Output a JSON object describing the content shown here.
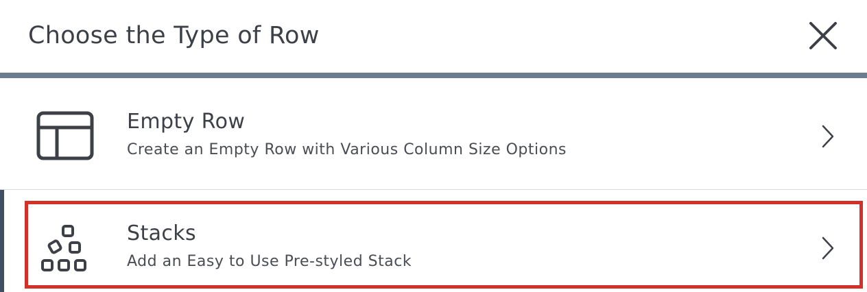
{
  "dialog": {
    "title": "Choose the Type of Row",
    "close_icon": "close-icon"
  },
  "options": [
    {
      "title": "Empty Row",
      "description": "Create an Empty Row with Various Column Size Options",
      "icon": "empty-row-layout-icon",
      "chevron_icon": "chevron-right-icon",
      "selected": false
    },
    {
      "title": "Stacks",
      "description": "Add an Easy to Use Pre-styled Stack",
      "icon": "stacks-blocks-icon",
      "chevron_icon": "chevron-right-icon",
      "selected": true
    }
  ],
  "colors": {
    "text": "#3d4046",
    "header_rule": "#6d7d91",
    "active_bar": "#3f4e63",
    "highlight": "#d3302a"
  }
}
